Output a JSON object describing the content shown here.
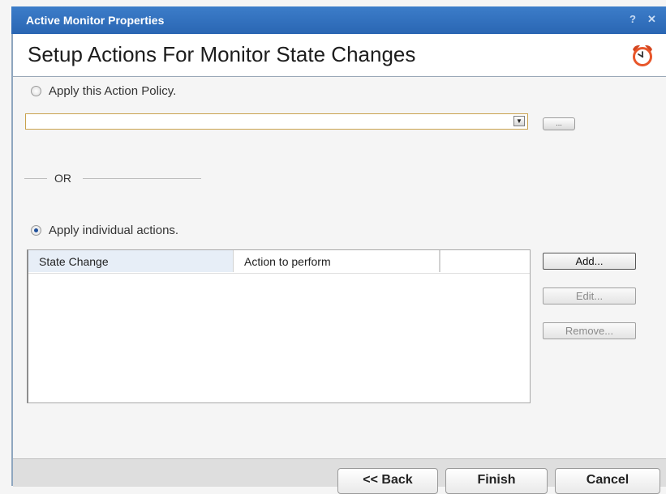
{
  "window": {
    "title": "Active Monitor Properties",
    "help_glyph": "?",
    "close_glyph": "✕"
  },
  "header": {
    "title": "Setup Actions For Monitor State Changes",
    "icon": "alarm-clock-icon"
  },
  "policy": {
    "radio_label": "Apply this Action Policy.",
    "selected": false,
    "dropdown_value": "",
    "browse_label": "..."
  },
  "separator": {
    "label": "OR"
  },
  "individual": {
    "radio_label": "Apply individual actions.",
    "selected": true,
    "columns": [
      "State Change",
      "Action to perform",
      ""
    ],
    "rows": []
  },
  "side_buttons": {
    "add": "Add...",
    "edit": "Edit...",
    "remove": "Remove..."
  },
  "footer": {
    "back": "<< Back",
    "finish": "Finish",
    "cancel": "Cancel"
  },
  "colors": {
    "titlebar": "#2f6fbf",
    "accent_radio": "#1f4f9a",
    "dropdown_border": "#c9a24d"
  }
}
